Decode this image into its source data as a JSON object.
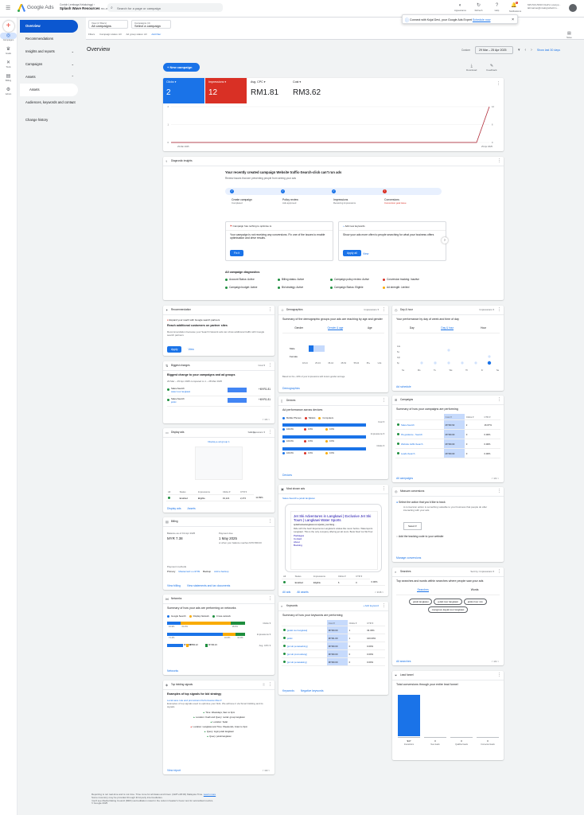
{
  "topbar": {
    "brand": "Google Ads",
    "acct_line1": "Contoh Lembaga Kelakoinggi ›",
    "acct_line2": "Splash Wave Resources",
    "acct_id": "651-055-4742 ▾",
    "search_placeholder": "Search for a page or campaign",
    "icons": [
      {
        "label": "Appearance",
        "icon": "appearance-icon"
      },
      {
        "label": "Refresh",
        "icon": "refresh-icon"
      },
      {
        "label": "Help",
        "icon": "help-icon"
      },
      {
        "label": "Notifications",
        "icon": "bell-icon",
        "badge": "1"
      }
    ],
    "user_line1": "625-513-5333 Ozell's Lowcyp...",
    "user_line2": "lahmariuo@mwkrgrwfactrm..."
  },
  "rail": [
    {
      "label": "Create",
      "icon": "plus-icon"
    },
    {
      "label": "Campaigns",
      "icon": "campaigns-icon"
    },
    {
      "label": "Goals",
      "icon": "trophy-icon"
    },
    {
      "label": "Tools",
      "icon": "tools-icon"
    },
    {
      "label": "Billing",
      "icon": "billing-icon"
    },
    {
      "label": "Admin",
      "icon": "gear-icon"
    }
  ],
  "nav": {
    "items": [
      {
        "label": "Overview",
        "active": true
      },
      {
        "label": "Recommendations"
      },
      {
        "label": "Insights and reports",
        "chev": "⌄"
      },
      {
        "label": "Campaigns",
        "chev": "⌄"
      },
      {
        "label": "Assets",
        "chev": "⌃"
      },
      {
        "label": "Assets",
        "sub": true
      },
      {
        "label": "Audiences, keywords and content",
        "chev": "⌄"
      },
      {
        "label": "Change history"
      }
    ]
  },
  "filters": {
    "view_label": "View (2 filters)",
    "view_value": "All campaigns",
    "camp_label": "Campaigns (4)",
    "camp_value": "Select a campaign",
    "links": [
      "Filters",
      "Campaign status: All",
      "Ad group status: All",
      "Add filter"
    ]
  },
  "toast": {
    "text": "Connect with Kojal Devi, your Google Ads Expert",
    "link": "Schedule now"
  },
  "save_label": "Save",
  "page_title": "Overview",
  "date": {
    "label": "Custom",
    "range": "29 Mar – 25 Apr 2025",
    "show_last": "Show last 30 days"
  },
  "new_campaign": "New campaign",
  "download_label": "Download",
  "feedback_label": "Feedback",
  "metrics": [
    {
      "label": "Clicks ▾",
      "value": "2",
      "bg": "#1a73e8",
      "fg": "#fff"
    },
    {
      "label": "Impressions ▾",
      "value": "12",
      "bg": "#d93025",
      "fg": "#fff"
    },
    {
      "label": "Avg. CPC ▾",
      "value": "RM1.81",
      "bg": "#fff",
      "fg": "#202124"
    },
    {
      "label": "Cost ▾",
      "value": "RM3.62",
      "bg": "#fff",
      "fg": "#202124"
    }
  ],
  "chart_data": {
    "type": "line",
    "x": [
      "29 Mar 2025",
      "25 Apr 2025"
    ],
    "series": [
      {
        "values": [
          0,
          0,
          0,
          0,
          0,
          0,
          0,
          0,
          0,
          0,
          0,
          0,
          0,
          0,
          0,
          0,
          0,
          0,
          0,
          0,
          0,
          0,
          0,
          0,
          0,
          2
        ],
        "color": "#1a73e8"
      },
      {
        "values": [
          0,
          0,
          0,
          0,
          0,
          0,
          0,
          0,
          0,
          0,
          0,
          0,
          0,
          0,
          0,
          0,
          0,
          0,
          0,
          0,
          0,
          0,
          0,
          0,
          0,
          12
        ],
        "color": "#d93025"
      }
    ],
    "y_left": [
      "2",
      "1",
      "0"
    ],
    "y_right": [
      "12",
      "6",
      "0"
    ]
  },
  "diag": {
    "header": "Diagnostic insights",
    "title": "Your recently created campaign Website traffic-Search-click can't run ads",
    "subtitle": "Review issues that are preventing people from seeing your ads",
    "steps": [
      {
        "t": "Create campaign",
        "s": "Completed"
      },
      {
        "t": "Policy review",
        "s": "Ads approved"
      },
      {
        "t": "Impressions",
        "s": "Receiving impressions"
      },
      {
        "t": "Conversions",
        "s": "Conversion goal issue"
      }
    ],
    "card1_hdr": "Campaign has nothing to optimise to",
    "card1_text": "Your campaign is not receiving any conversions. Fix one of the issues to enable optimisation and drive results.",
    "card1_btn": "Fix it",
    "card2_hdr": "Add new keywords",
    "card2_text": "Show your ads more often to people searching for what your business offers",
    "card2_btn": "Apply all",
    "card2_link": "View",
    "all_title": "All campaign diagnostics",
    "all": [
      {
        "t": "Account Status: Active",
        "c": "green"
      },
      {
        "t": "Billing status: Active",
        "c": "green"
      },
      {
        "t": "Campaign policy review: Active",
        "c": "green"
      },
      {
        "t": "Conversion tracking: Inactive",
        "c": "red"
      },
      {
        "t": "Campaign budget: Active",
        "c": "green"
      },
      {
        "t": "Bid strategy: Active",
        "c": "green"
      },
      {
        "t": "Campaign Status: Eligible",
        "c": "green"
      },
      {
        "t": "Ad strength: Limited",
        "c": "orange"
      }
    ]
  },
  "rec": {
    "header": "Recommendation",
    "line": "Expand your reach with Google search partners",
    "title": "Reach additional customers on partner sites",
    "text": "Recommendation because your Search Network ads can show additional traffic with Google search partners",
    "apply": "Apply",
    "view": "View"
  },
  "bigchanges": {
    "header": "Biggest changes",
    "sel": "Cost ▾",
    "title": "Biggest change to your campaigns and ad groups",
    "sub": "29 Mar – 25 Apr 2025 compared to 1 – 28 Mar 2025",
    "rows": [
      {
        "a": "Sales-Search",
        "b": "water tour langkawi",
        "v": "+MYR1.81"
      },
      {
        "a": "Sales-Search",
        "b": "jetski",
        "v": "+MYR1.81"
      }
    ],
    "pager": "< 1/1 >"
  },
  "displayads": {
    "header": "Display ads",
    "sort": "Sort by",
    "sortv": "Impressions ▾",
    "ad_label": "Display  ▸ ad group 1",
    "cols": [
      "All",
      "Status",
      "Impressions",
      "Clicks ▾",
      "CTR ▾"
    ],
    "row": [
      "Enabled",
      "Eligible",
      "19,121",
      "2,274",
      "11.89%"
    ],
    "links": [
      "Display ads",
      "Assets"
    ]
  },
  "billing": {
    "header": "Billing",
    "bal_label": "Balance as of 19 Apr 2025",
    "bal": "MYR 7.38",
    "pay_label": "Payment due",
    "pay": "1 May 2025",
    "pay_note": "or when your balance reaches MYR 800.00",
    "pm_label": "Payment methods",
    "pm_primary": "Primary",
    "pm_card": "Mastercard ••••3709",
    "pm_backup": "Backup",
    "pm_add": "Add a backup",
    "links": [
      "View billing",
      "View statements and tax documents"
    ]
  },
  "networks": {
    "header": "Networks",
    "title": "Summary of how your ads are performing on networks",
    "legend": [
      "Google Search",
      "Display Network",
      "Cross-network"
    ],
    "rows": [
      {
        "l": "Clicks ▾",
        "v": [
          "16.9%",
          "64.3%",
          "18.9%"
        ]
      },
      {
        "l": "Impressions ▾",
        "v": [
          "71.4%",
          "16.6%",
          "12.0%"
        ]
      },
      {
        "l": "Avg. CPC ▾",
        "v": [
          "MYR2.67",
          "MYR0.22",
          "MYR0.23"
        ]
      }
    ],
    "link": "Networks"
  },
  "topsignals": {
    "header": "Top bidding signals",
    "title": "Examples of top signals for bid strategy",
    "sub": "Local save rule and promotions   Performance Max ▾",
    "text": "Examples of top signals used to optimise your bids. We achieve it via Smart bidding and its signals",
    "items": [
      "Time: Weekdays, 9am to 3pm",
      "Location: Kuah and Query: rental: group langkawi",
      "Location: Selat",
      "Location: Langkawi and Time: Weekends, 11am to 3pm",
      "Query: login jetski langkawi",
      "Query: jetski langkawi"
    ],
    "link": "View report",
    "pager": "< 1/2 >"
  },
  "demog": {
    "header": "Demographics",
    "sel": "Impressions ▾",
    "title": "Summary of the demographic groups your ads are reaching by age and gender",
    "tabs": [
      "Gender",
      "Gender & age",
      "Age"
    ],
    "rows": [
      "Male",
      "Female"
    ],
    "ages": [
      "18-24",
      "25-34",
      "35-44",
      "45-54",
      "55-64",
      "65+",
      "Unk."
    ],
    "note": "Based on the ~33% of your impressions with known gender and age",
    "link": "Demographics"
  },
  "devices": {
    "header": "Devices",
    "title": "Ad performance across devices",
    "legend": [
      "Mobile Phones",
      "Tablets",
      "Computers"
    ],
    "rows": [
      {
        "l": "Cost ▾",
        "v": [
          "100.0%",
          "0.0%",
          "0.0%"
        ]
      },
      {
        "l": "Impressions ▾",
        "v": [
          "100.0%",
          "0.0%",
          "0.0%"
        ]
      },
      {
        "l": "Clicks ▾",
        "v": [
          "100.0%",
          "0.0%",
          "0.0%"
        ]
      }
    ],
    "link": "Devices"
  },
  "mostshown": {
    "header": "Most shown ads",
    "path": "Sales-Search  ▸ jetski langkawi",
    "ad_title": "Jet Ski Adventures in Langkawi | Exclusive Jet Ski Tours | Langkawi Water Sports",
    "ad_url": "splashwavelangkawi.com/jetski_tour/lang...",
    "ad_body": "Ride with the best! Experience Langkawi's azalea like never before. Watersports Langkawi. This is the only company offering jet ski tours. Book Now! Jet Ski Tour",
    "ad_sitelinks": [
      "Packages",
      "Contact",
      "About",
      "Booking"
    ],
    "cols": [
      "All",
      "Status",
      "Impressions",
      "Clicks ▾",
      "CTR ▾"
    ],
    "row": [
      "Enabled",
      "Eligible",
      "6",
      "0",
      "0.00%"
    ],
    "links": [
      "All ads",
      "All assets"
    ],
    "pager": "< 1/16 >"
  },
  "keywords": {
    "header": "Keywords",
    "add": "Add keyword",
    "title": "Summary of how your keywords are performing",
    "cols": [
      "",
      "Cost ▾",
      "Clicks ▾",
      "CTR ▾"
    ],
    "rows": [
      [
        "[jetski tour langkawi]",
        "MYR0.00",
        "1",
        "33.33%"
      ],
      [
        "jetski",
        "MYR1.00",
        "1",
        "100.00%"
      ],
      [
        "[jet ski penawarking]",
        "MYR0.00",
        "0",
        "0.00%"
      ],
      [
        "[jet ski promosilang]",
        "MYR0.00",
        "0",
        "0.00%"
      ],
      [
        "[jet ski penawaking]",
        "MYR0.00",
        "0",
        "0.00%"
      ]
    ],
    "links": [
      "Keywords",
      "Negative keywords"
    ]
  },
  "dayhour": {
    "header": "Day & hour",
    "sel": "Impressions ▾",
    "title": "Your performance by day of week and time of day",
    "tabs": [
      "Day",
      "Day & hour",
      "Hour"
    ],
    "days": [
      "Su",
      "Mo",
      "Tu",
      "We",
      "Th",
      "Fr",
      "Sa"
    ],
    "hours": [
      "12a",
      "6a",
      "12p",
      "6p"
    ],
    "link": "Ad schedule"
  },
  "campaigns": {
    "header": "Campaigns",
    "title": "Summary of how your campaigns are performing",
    "cols": [
      "",
      "Cost ▾",
      "Clicks ▾",
      "CTR ▾"
    ],
    "rows": [
      [
        "Sales-Search",
        "MYR3.62",
        "2",
        "16.67%"
      ],
      [
        "Pk-guidance - Search",
        "MYR0.00",
        "0",
        "0.00%"
      ],
      [
        "Website traffic-Search",
        "MYR0.00",
        "0",
        "0.00%"
      ],
      [
        "Leads-Search",
        "MYR0.00",
        "0",
        "0.00%"
      ]
    ],
    "link": "All campaigns",
    "pager": "< 1/1 >"
  },
  "conv": {
    "header": "Measure conversions",
    "q": "Select the action that you'd like to track",
    "text": "A conversion action is something valuable to your business that people do after interacting with your ads",
    "select": "Select ▾",
    "q2": "Add the tracking code to your website",
    "link": "Manage conversions"
  },
  "searches": {
    "header": "Searches",
    "sel": "Sort by: Impressions ▾",
    "title": "Top searches and words within searches where people saw your ads",
    "tabs": [
      "Searches",
      "Words"
    ],
    "pills": [
      "jetski langkawi",
      "jetski tour langkawi",
      "jetski river mix",
      "mangrove kayak tour langkawi"
    ],
    "link": "All searches",
    "pager": "< 1/1 >"
  },
  "leadfunnel": {
    "header": "Lead funnel",
    "title": "Total conversions through your entire lead funnel",
    "cats": [
      "Interactions",
      "New leads",
      "Qualified leads",
      "Converted leads"
    ],
    "vals": [
      "$47",
      "0",
      "0",
      "0"
    ],
    "fill": [
      1,
      0,
      0,
      0
    ]
  },
  "footer": {
    "line1": "Reporting is not real-time and is not time. Time zone for all dates and times: (GMT+08:00) Malaysia Time.",
    "link1": "Learn more",
    "line2": "Some inventory may be provided through third party intermediaries.",
    "line3": "You'll see Media Rating Council (MRC) accreditation noted in the column header's hover text for accredited metrics.",
    "line4": "© Google 2025"
  }
}
